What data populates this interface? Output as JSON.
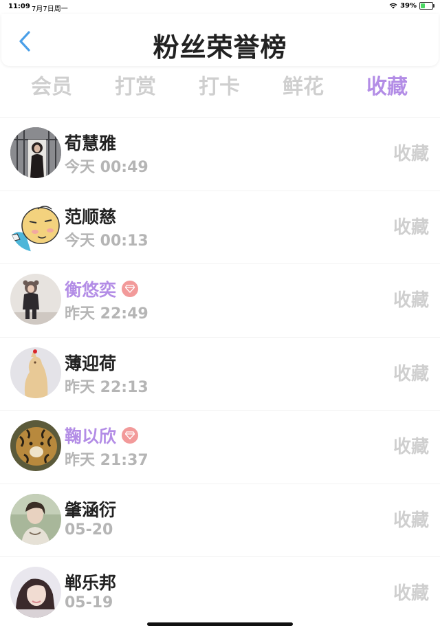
{
  "status_bar": {
    "time": "11:09",
    "date": "7月7日周一",
    "battery_percent": "39%",
    "battery_level": 0.39
  },
  "header": {
    "title": "粉丝荣誉榜",
    "back_icon": "chevron-left-icon"
  },
  "tabs": [
    {
      "label": "会员",
      "active": false
    },
    {
      "label": "打赏",
      "active": false
    },
    {
      "label": "打卡",
      "active": false
    },
    {
      "label": "鲜花",
      "active": false
    },
    {
      "label": "收藏",
      "active": true
    }
  ],
  "colors": {
    "accent": "#b38de6",
    "inactive_tab": "#cfcfcf",
    "vip_badge": "#f29a9a"
  },
  "fans": [
    {
      "name": "荀慧雅",
      "time": "今天 00:49",
      "action": "收藏",
      "vip": false
    },
    {
      "name": "范顺慈",
      "time": "今天 00:13",
      "action": "收藏",
      "vip": false
    },
    {
      "name": "衡悠奕",
      "time": "昨天 22:49",
      "action": "收藏",
      "vip": true
    },
    {
      "name": "薄迎荷",
      "time": "昨天 22:13",
      "action": "收藏",
      "vip": false
    },
    {
      "name": "鞠以欣",
      "time": "昨天 21:37",
      "action": "收藏",
      "vip": true
    },
    {
      "name": "肇涵衍",
      "time": "05-20",
      "action": "收藏",
      "vip": false
    },
    {
      "name": "郸乐邦",
      "time": "05-19",
      "action": "收藏",
      "vip": false
    }
  ]
}
